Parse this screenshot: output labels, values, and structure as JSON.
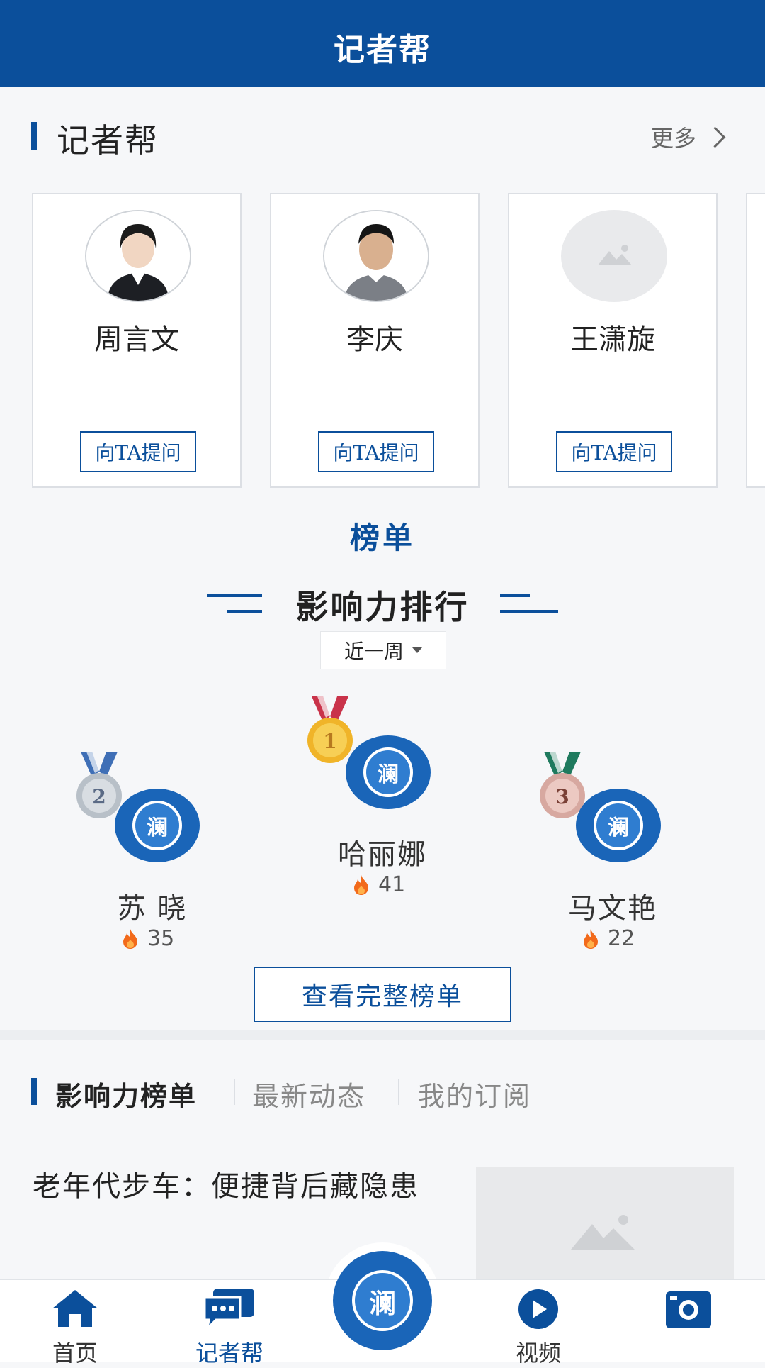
{
  "header": {
    "title": "记者帮"
  },
  "section": {
    "title": "记者帮",
    "more_label": "更多"
  },
  "journalists": [
    {
      "name": "周言文",
      "ask_label": "向TA提问",
      "avatar": "photo-female"
    },
    {
      "name": "李庆",
      "ask_label": "向TA提问",
      "avatar": "photo-male"
    },
    {
      "name": "王潇旋",
      "ask_label": "向TA提问",
      "avatar": "placeholder-image-icon"
    }
  ],
  "ranking": {
    "title": "榜单",
    "influence_title": "影响力排行",
    "period": "近一周",
    "badge_char": "澜",
    "entries": [
      {
        "rank": "1",
        "name": "哈丽娜",
        "score": "41"
      },
      {
        "rank": "2",
        "name": "苏 晓",
        "score": "35"
      },
      {
        "rank": "3",
        "name": "马文艳",
        "score": "22"
      }
    ],
    "full_list_label": "查看完整榜单"
  },
  "tabs": [
    {
      "label": "影响力榜单",
      "active": true
    },
    {
      "label": "最新动态",
      "active": false
    },
    {
      "label": "我的订阅",
      "active": false
    }
  ],
  "news": [
    {
      "title": "老年代步车：便捷背后藏隐患"
    }
  ],
  "bottom_nav": {
    "items": [
      {
        "label": "首页",
        "icon": "home-icon"
      },
      {
        "label": "记者帮",
        "icon": "chat-icon"
      },
      {
        "label": "",
        "icon": "lan-center-icon"
      },
      {
        "label": "视频",
        "icon": "play-icon"
      },
      {
        "label": "",
        "icon": "camera-icon"
      }
    ],
    "center_char": "澜"
  },
  "colors": {
    "primary": "#0b4f9b",
    "gold": "#f0b429",
    "silver": "#b8c0c8",
    "bronze": "#d7a8a0",
    "fire": "#f26a1b"
  }
}
